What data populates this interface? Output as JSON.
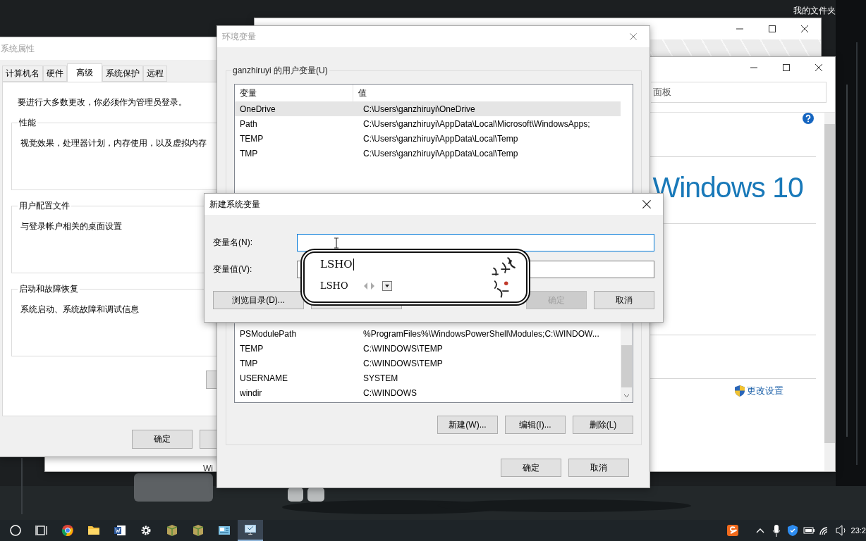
{
  "desktop": {
    "folder_label": "我的文件夹"
  },
  "control_panel": {
    "address": "面板",
    "logo": "Windows 10",
    "link": "更改设置",
    "bottom_text": "Wi"
  },
  "system_properties": {
    "title": "系统属性",
    "tabs": [
      {
        "label": "计算机名",
        "selected": false
      },
      {
        "label": "硬件",
        "selected": false
      },
      {
        "label": "高级",
        "selected": true
      },
      {
        "label": "系统保护",
        "selected": false
      },
      {
        "label": "远程",
        "selected": false
      }
    ],
    "notice": "要进行大多数更改，你必须作为管理员登录。",
    "groups": [
      {
        "title": "性能",
        "description": "视觉效果，处理器计划，内存使用，以及虚拟内存"
      },
      {
        "title": "用户配置文件",
        "description": "与登录帐户相关的桌面设置"
      },
      {
        "title": "启动和故障恢复",
        "description": "系统启动、系统故障和调试信息"
      }
    ],
    "buttons": [
      "确定"
    ]
  },
  "environment_variables": {
    "title": "环境变量",
    "user_group": "ganzhiruyi 的用户变量(U)",
    "columns": [
      "变量",
      "值"
    ],
    "user_rows": [
      {
        "name": "OneDrive",
        "value": "C:\\Users\\ganzhiruyi\\OneDrive",
        "selected": true
      },
      {
        "name": "Path",
        "value": "C:\\Users\\ganzhiruyi\\AppData\\Local\\Microsoft\\WindowsApps;",
        "selected": false
      },
      {
        "name": "TEMP",
        "value": "C:\\Users\\ganzhiruyi\\AppData\\Local\\Temp",
        "selected": false
      },
      {
        "name": "TMP",
        "value": "C:\\Users\\ganzhiruyi\\AppData\\Local\\Temp",
        "selected": false
      }
    ],
    "system_rows": [
      {
        "name": "PSModulePath",
        "value": "%ProgramFiles%\\WindowsPowerShell\\Modules;C:\\WINDOW...",
        "selected": false
      },
      {
        "name": "TEMP",
        "value": "C:\\WINDOWS\\TEMP",
        "selected": false
      },
      {
        "name": "TMP",
        "value": "C:\\WINDOWS\\TEMP",
        "selected": false
      },
      {
        "name": "USERNAME",
        "value": "SYSTEM",
        "selected": false
      },
      {
        "name": "windir",
        "value": "C:\\WINDOWS",
        "selected": false
      }
    ],
    "list_buttons": [
      "新建(W)...",
      "编辑(I)...",
      "删除(L)"
    ],
    "buttons": [
      "确定",
      "取消"
    ]
  },
  "new_variable_dialog": {
    "title": "新建系统变量",
    "fields": [
      {
        "label": "变量名(N):",
        "focused": true
      },
      {
        "label": "变量值(V):",
        "focused": false
      }
    ],
    "buttons": [
      {
        "label": "浏览目录(D)...",
        "disabled": false
      },
      {
        "label": "确定",
        "disabled": true
      },
      {
        "label": "取消",
        "disabled": false
      }
    ]
  },
  "ime": {
    "composition": "LSHO",
    "candidate": "LSHO"
  },
  "taskbar": {
    "clock": "23:2"
  }
}
